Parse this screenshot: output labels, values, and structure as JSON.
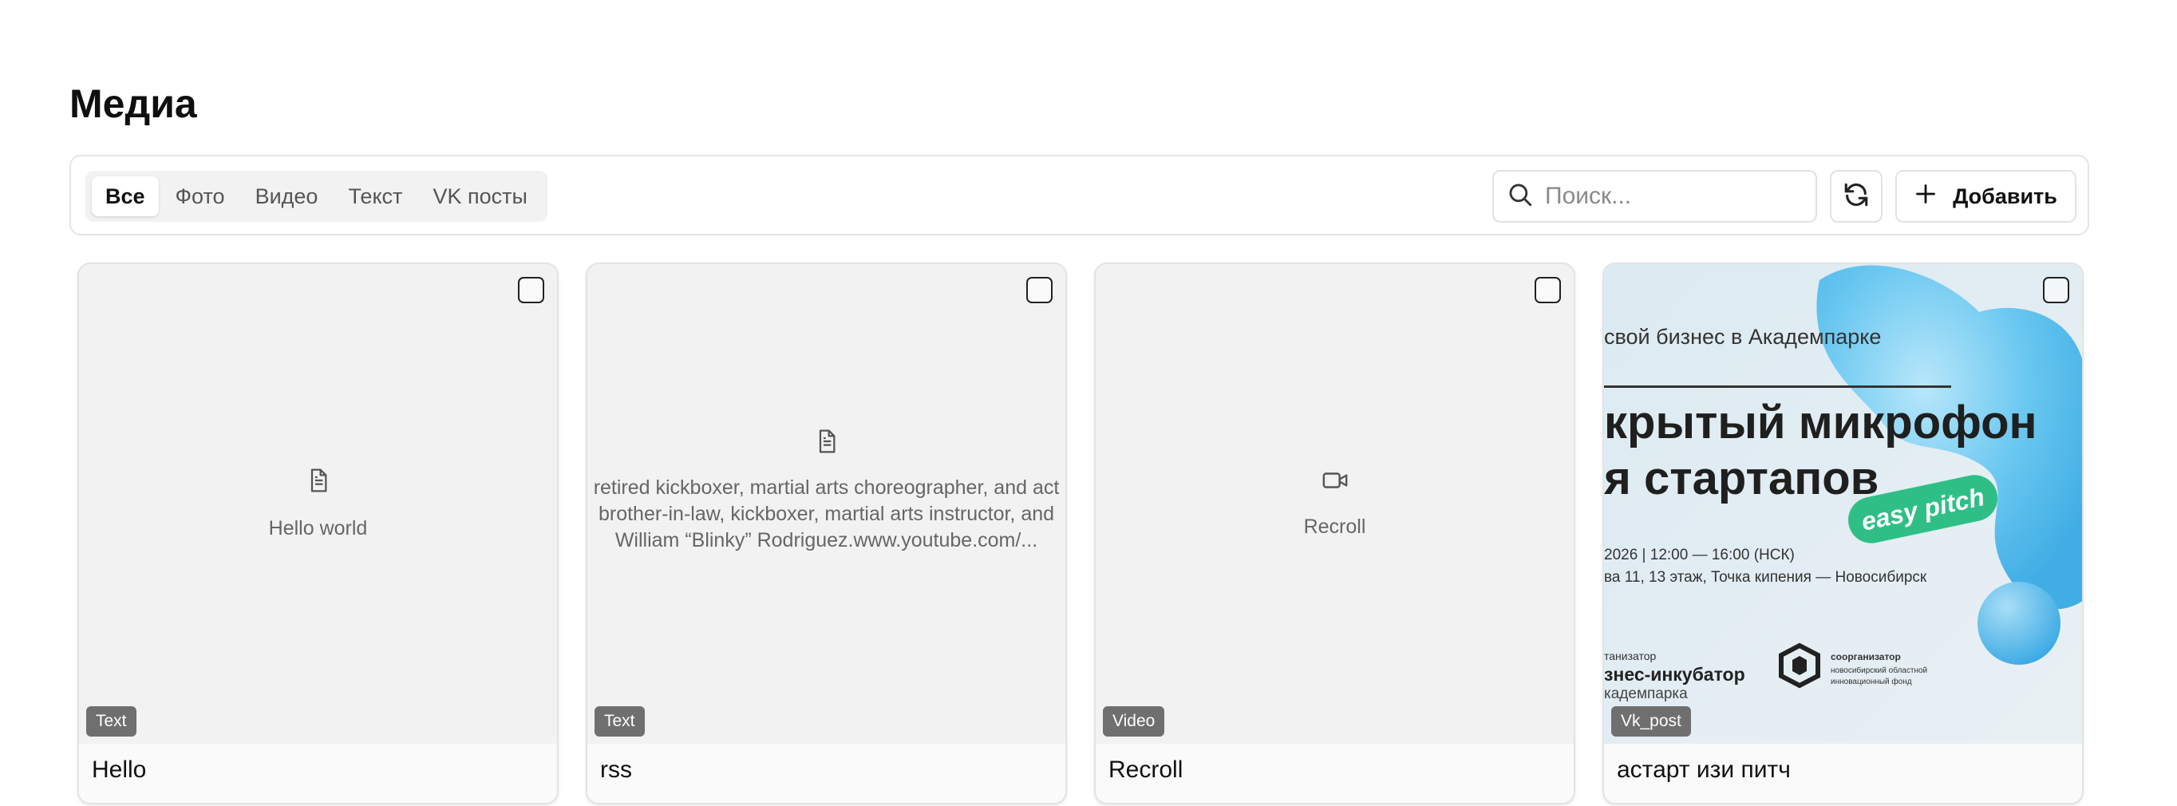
{
  "page": {
    "title": "Медиа"
  },
  "toolbar": {
    "tabs": [
      {
        "label": "Все",
        "active": true
      },
      {
        "label": "Фото",
        "active": false
      },
      {
        "label": "Видео",
        "active": false
      },
      {
        "label": "Текст",
        "active": false
      },
      {
        "label": "VK посты",
        "active": false
      }
    ],
    "search": {
      "placeholder": "Поиск...",
      "value": "",
      "icon": "search-icon"
    },
    "refresh": {
      "icon": "refresh-icon"
    },
    "add": {
      "label": "Добавить",
      "icon": "plus-icon"
    }
  },
  "cards": [
    {
      "type": "Text",
      "icon": "document-icon",
      "preview_text": "Hello world",
      "title": "Hello",
      "checked": false
    },
    {
      "type": "Text",
      "icon": "document-icon",
      "preview_lines": [
        "retired kickboxer, martial arts choreographer, and act",
        "brother-in-law, kickboxer, martial arts instructor, and",
        "William “Blinky” Rodriguez.www.youtube.com/..."
      ],
      "title": "rss",
      "checked": false
    },
    {
      "type": "Video",
      "icon": "video-camera-icon",
      "preview_text": "Recroll",
      "title": "Recroll",
      "checked": false
    },
    {
      "type": "Vk_post",
      "title": "астарт изи питч",
      "checked": false,
      "image": {
        "line1": "свой бизнес в Академпарке",
        "headline1": "крытый микрофон",
        "headline2": "я стартапов",
        "sticker": "easy pitch",
        "date_line": "2026 | 12:00 — 16:00 (НСК)",
        "place_line": "ва 11, 13 этаж, Точка кипения — Новосибирск",
        "org_label": "танизатор",
        "org_name": "знес-инкубатор",
        "org_sub": "кадемпарка",
        "coorg_label": "соорганизатор",
        "coorg_name1": "новосибирский областной",
        "coorg_name2": "инновационный фонд"
      }
    }
  ]
}
